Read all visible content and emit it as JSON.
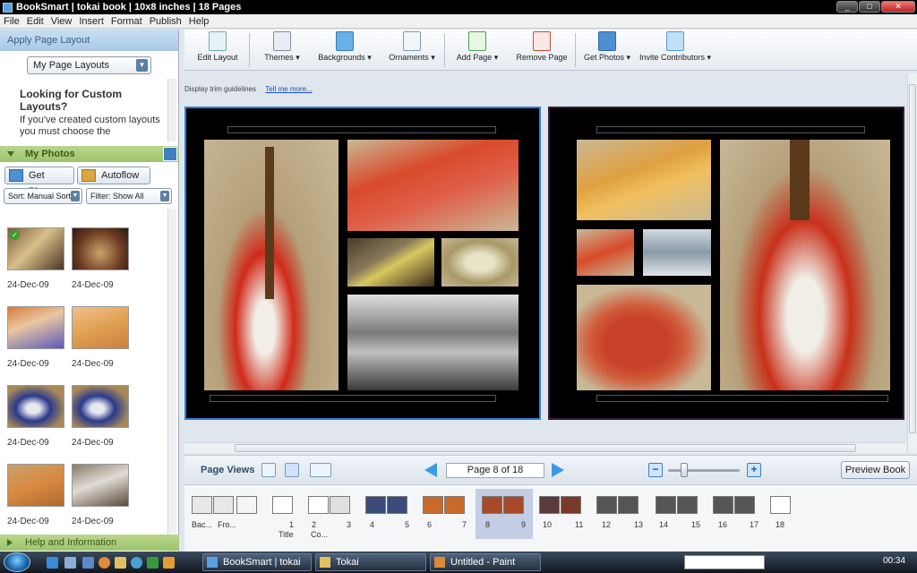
{
  "window": {
    "title": "BookSmart | tokai book | 10x8 inches | 18 Pages"
  },
  "menu": [
    "File",
    "Edit",
    "View",
    "Insert",
    "Format",
    "Publish",
    "Help"
  ],
  "left": {
    "apply_layout_title": "Apply Page Layout",
    "layout_select": "My Page Layouts",
    "custom_heading": "Looking for Custom Layouts?",
    "custom_text": "If you've created custom layouts you must choose the",
    "my_photos_title": "My Photos",
    "get_photos": "Get Photos",
    "autoflow": "Autoflow",
    "sort": "Sort: Manual Sort",
    "filter": "Filter: Show All",
    "photo_dates": [
      "24-Dec-09",
      "24-Dec-09",
      "24-Dec-09",
      "24-Dec-09",
      "24-Dec-09",
      "24-Dec-09",
      "24-Dec-09",
      "24-Dec-09"
    ],
    "help_title": "Help and Information"
  },
  "toolbar": {
    "edit_layout": "Edit Layout",
    "themes": "Themes ▾",
    "backgrounds": "Backgrounds ▾",
    "ornaments": "Ornaments ▾",
    "add_page": "Add Page ▾",
    "remove_page": "Remove Page",
    "get_photos": "Get Photos ▾",
    "invite": "Invite Contributors ▾"
  },
  "trim": {
    "label": "Display trim guidelines",
    "link": "Tell me more..."
  },
  "pageviews": {
    "label": "Page Views",
    "page_indicator": "Page 8 of 18",
    "preview": "Preview Book"
  },
  "filmstrip": {
    "labels": [
      {
        "num": "Bac...",
        "sub": ""
      },
      {
        "num": "Fro...",
        "sub": ""
      },
      {
        "num": "1",
        "sub": "Title"
      },
      {
        "num": "2",
        "sub": "Co..."
      },
      {
        "num": "3",
        "sub": ""
      },
      {
        "num": "4",
        "sub": ""
      },
      {
        "num": "5",
        "sub": ""
      },
      {
        "num": "6",
        "sub": ""
      },
      {
        "num": "7",
        "sub": ""
      },
      {
        "num": "8",
        "sub": ""
      },
      {
        "num": "9",
        "sub": ""
      },
      {
        "num": "10",
        "sub": ""
      },
      {
        "num": "11",
        "sub": ""
      },
      {
        "num": "12",
        "sub": ""
      },
      {
        "num": "13",
        "sub": ""
      },
      {
        "num": "14",
        "sub": ""
      },
      {
        "num": "15",
        "sub": ""
      },
      {
        "num": "16",
        "sub": ""
      },
      {
        "num": "17",
        "sub": ""
      },
      {
        "num": "18",
        "sub": ""
      }
    ]
  },
  "taskbar": {
    "tasks": [
      "BookSmart | tokai ...",
      "Tokai",
      "Untitled - Paint"
    ],
    "clock": "00:34"
  },
  "colors": {
    "accent": "#2f7fd8",
    "photos_header": "#9dc36b",
    "selected_spread": "#c3cee4"
  }
}
